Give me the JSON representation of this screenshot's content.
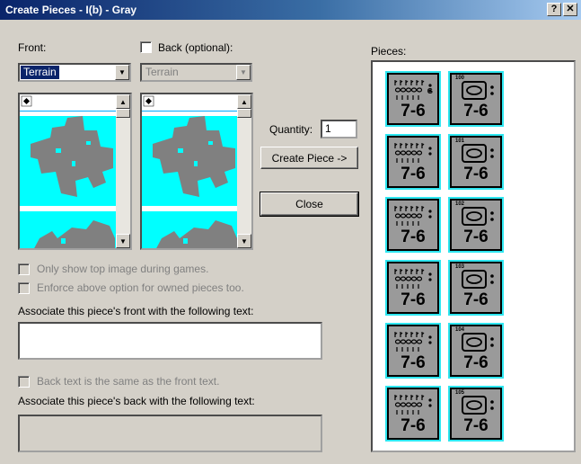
{
  "window": {
    "title": "Create Pieces - I(b) - Gray",
    "help_label": "?",
    "close_label": "✕"
  },
  "front": {
    "label": "Front:",
    "combo_value": "Terrain"
  },
  "back": {
    "label": "Back (optional):",
    "combo_value": "Terrain"
  },
  "quantity": {
    "label": "Quantity:",
    "value": "1"
  },
  "buttons": {
    "create_piece": "Create Piece ->",
    "close": "Close"
  },
  "options": {
    "only_top_image": "Only show top image during games.",
    "enforce_owned": "Enforce above option for owned pieces too.",
    "front_text_label": "Associate this piece's front with the following text:",
    "front_text_value": "",
    "back_same": "Back text is the same as the front text.",
    "back_text_label": "Associate this piece's back with the following text:",
    "back_text_value": ""
  },
  "pieces": {
    "label": "Pieces:",
    "items": [
      {
        "front_factor": "7-6",
        "back_factor": "7-6",
        "number": "100",
        "grade": "G"
      },
      {
        "front_factor": "7-6",
        "back_factor": "7-6",
        "number": "101",
        "grade": ""
      },
      {
        "front_factor": "7-6",
        "back_factor": "7-6",
        "number": "102",
        "grade": ""
      },
      {
        "front_factor": "7-6",
        "back_factor": "7-6",
        "number": "103",
        "grade": ""
      },
      {
        "front_factor": "7-6",
        "back_factor": "7-6",
        "number": "104",
        "grade": ""
      },
      {
        "front_factor": "7-6",
        "back_factor": "7-6",
        "number": "105",
        "grade": ""
      }
    ]
  },
  "colors": {
    "title_bar": "#0a246a",
    "terrain_water": "#00ffff",
    "terrain_land": "#808080",
    "counter_border": "#2ee6f0",
    "counter_face": "#9a9a9a"
  }
}
